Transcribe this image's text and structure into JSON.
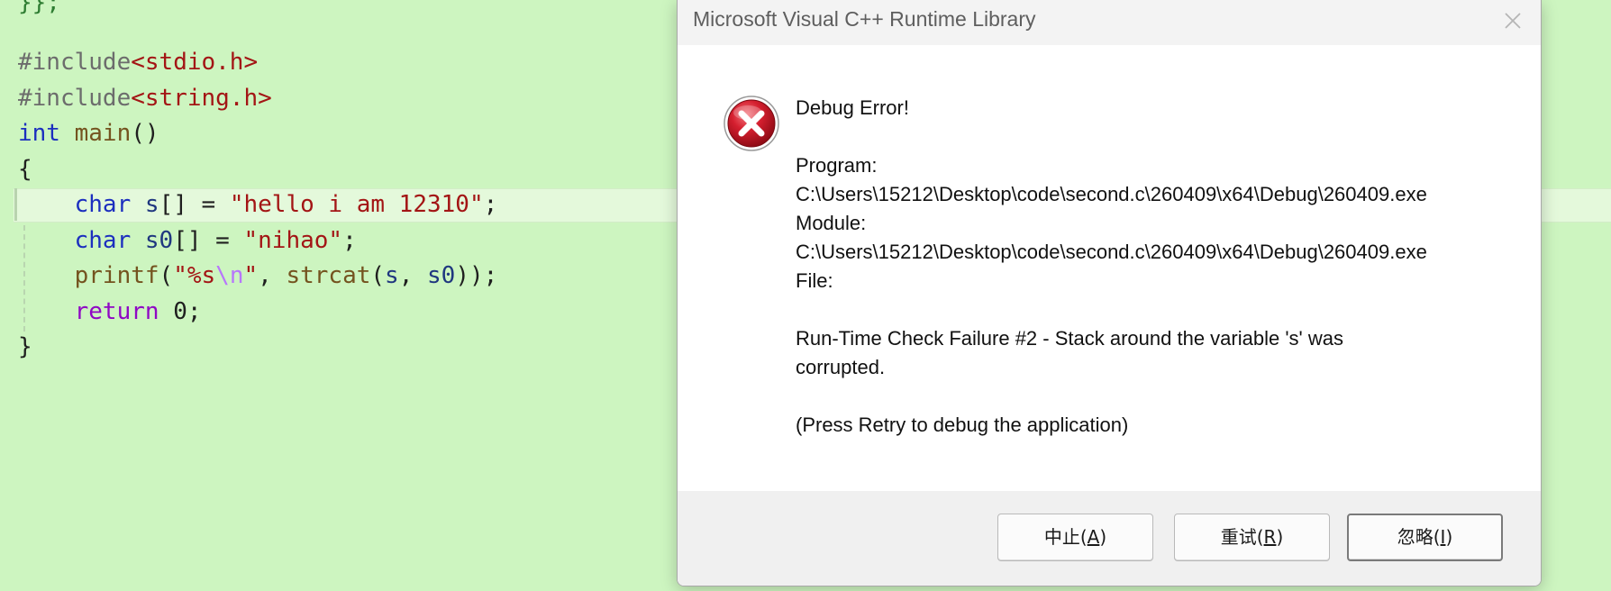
{
  "editor": {
    "top_trace": "}};",
    "lines": [
      [
        {
          "t": "#include",
          "c": "dir"
        },
        {
          "t": "<stdio.h>",
          "c": "hdr"
        }
      ],
      [
        {
          "t": "#include",
          "c": "dir"
        },
        {
          "t": "<string.h>",
          "c": "hdr"
        }
      ],
      [
        {
          "t": "int",
          "c": "kw"
        },
        {
          "t": " ",
          "c": "pun"
        },
        {
          "t": "main",
          "c": "fn"
        },
        {
          "t": "()",
          "c": "pun"
        }
      ],
      [
        {
          "t": "{",
          "c": "pun"
        }
      ],
      [
        {
          "t": "    ",
          "c": "pun"
        },
        {
          "t": "char",
          "c": "kw"
        },
        {
          "t": " ",
          "c": "pun"
        },
        {
          "t": "s",
          "c": "var"
        },
        {
          "t": "[] = ",
          "c": "pun"
        },
        {
          "t": "\"hello i am 12310\"",
          "c": "str"
        },
        {
          "t": ";",
          "c": "pun"
        }
      ],
      [
        {
          "t": "    ",
          "c": "pun"
        },
        {
          "t": "char",
          "c": "kw"
        },
        {
          "t": " ",
          "c": "pun"
        },
        {
          "t": "s0",
          "c": "var"
        },
        {
          "t": "[] = ",
          "c": "pun"
        },
        {
          "t": "\"nihao\"",
          "c": "str"
        },
        {
          "t": ";",
          "c": "pun"
        }
      ],
      [
        {
          "t": "    ",
          "c": "pun"
        },
        {
          "t": "printf",
          "c": "fn"
        },
        {
          "t": "(",
          "c": "pun"
        },
        {
          "t": "\"%s",
          "c": "str"
        },
        {
          "t": "\\n",
          "c": "esc"
        },
        {
          "t": "\"",
          "c": "str"
        },
        {
          "t": ", ",
          "c": "pun"
        },
        {
          "t": "strcat",
          "c": "fn"
        },
        {
          "t": "(",
          "c": "pun"
        },
        {
          "t": "s",
          "c": "var"
        },
        {
          "t": ", ",
          "c": "pun"
        },
        {
          "t": "s0",
          "c": "var"
        },
        {
          "t": "));",
          "c": "pun"
        }
      ],
      [
        {
          "t": "    ",
          "c": "pun"
        },
        {
          "t": "return",
          "c": "ctl"
        },
        {
          "t": " ",
          "c": "pun"
        },
        {
          "t": "0",
          "c": "num"
        },
        {
          "t": ";",
          "c": "pun"
        }
      ],
      [
        {
          "t": "}",
          "c": "pun"
        }
      ]
    ]
  },
  "dialog": {
    "title": "Microsoft Visual C++ Runtime Library",
    "close_glyph": "✕",
    "icon": "error-x-icon",
    "heading": "Debug Error!",
    "program_label": "Program:",
    "program_path": "C:\\Users\\15212\\Desktop\\code\\second.c\\260409\\x64\\Debug\\260409.exe",
    "module_label": "Module:",
    "module_path": "C:\\Users\\15212\\Desktop\\code\\second.c\\260409\\x64\\Debug\\260409.exe",
    "file_label": "File:",
    "failure_line1": "Run-Time Check Failure #2 - Stack around the variable 's' was",
    "failure_line2": "corrupted.",
    "hint": "(Press Retry to debug the application)",
    "buttons": {
      "abort": {
        "prefix": "中止(",
        "mnemonic": "A",
        "suffix": ")"
      },
      "retry": {
        "prefix": "重试(",
        "mnemonic": "R",
        "suffix": ")"
      },
      "ignore": {
        "prefix": "忽略(",
        "mnemonic": "I",
        "suffix": ")"
      }
    }
  },
  "colors": {
    "editor_bg": "#cdf5c0",
    "keyword": "#1c2fbf",
    "string": "#a31515",
    "function": "#74531f",
    "error_red": "#c8102e"
  }
}
